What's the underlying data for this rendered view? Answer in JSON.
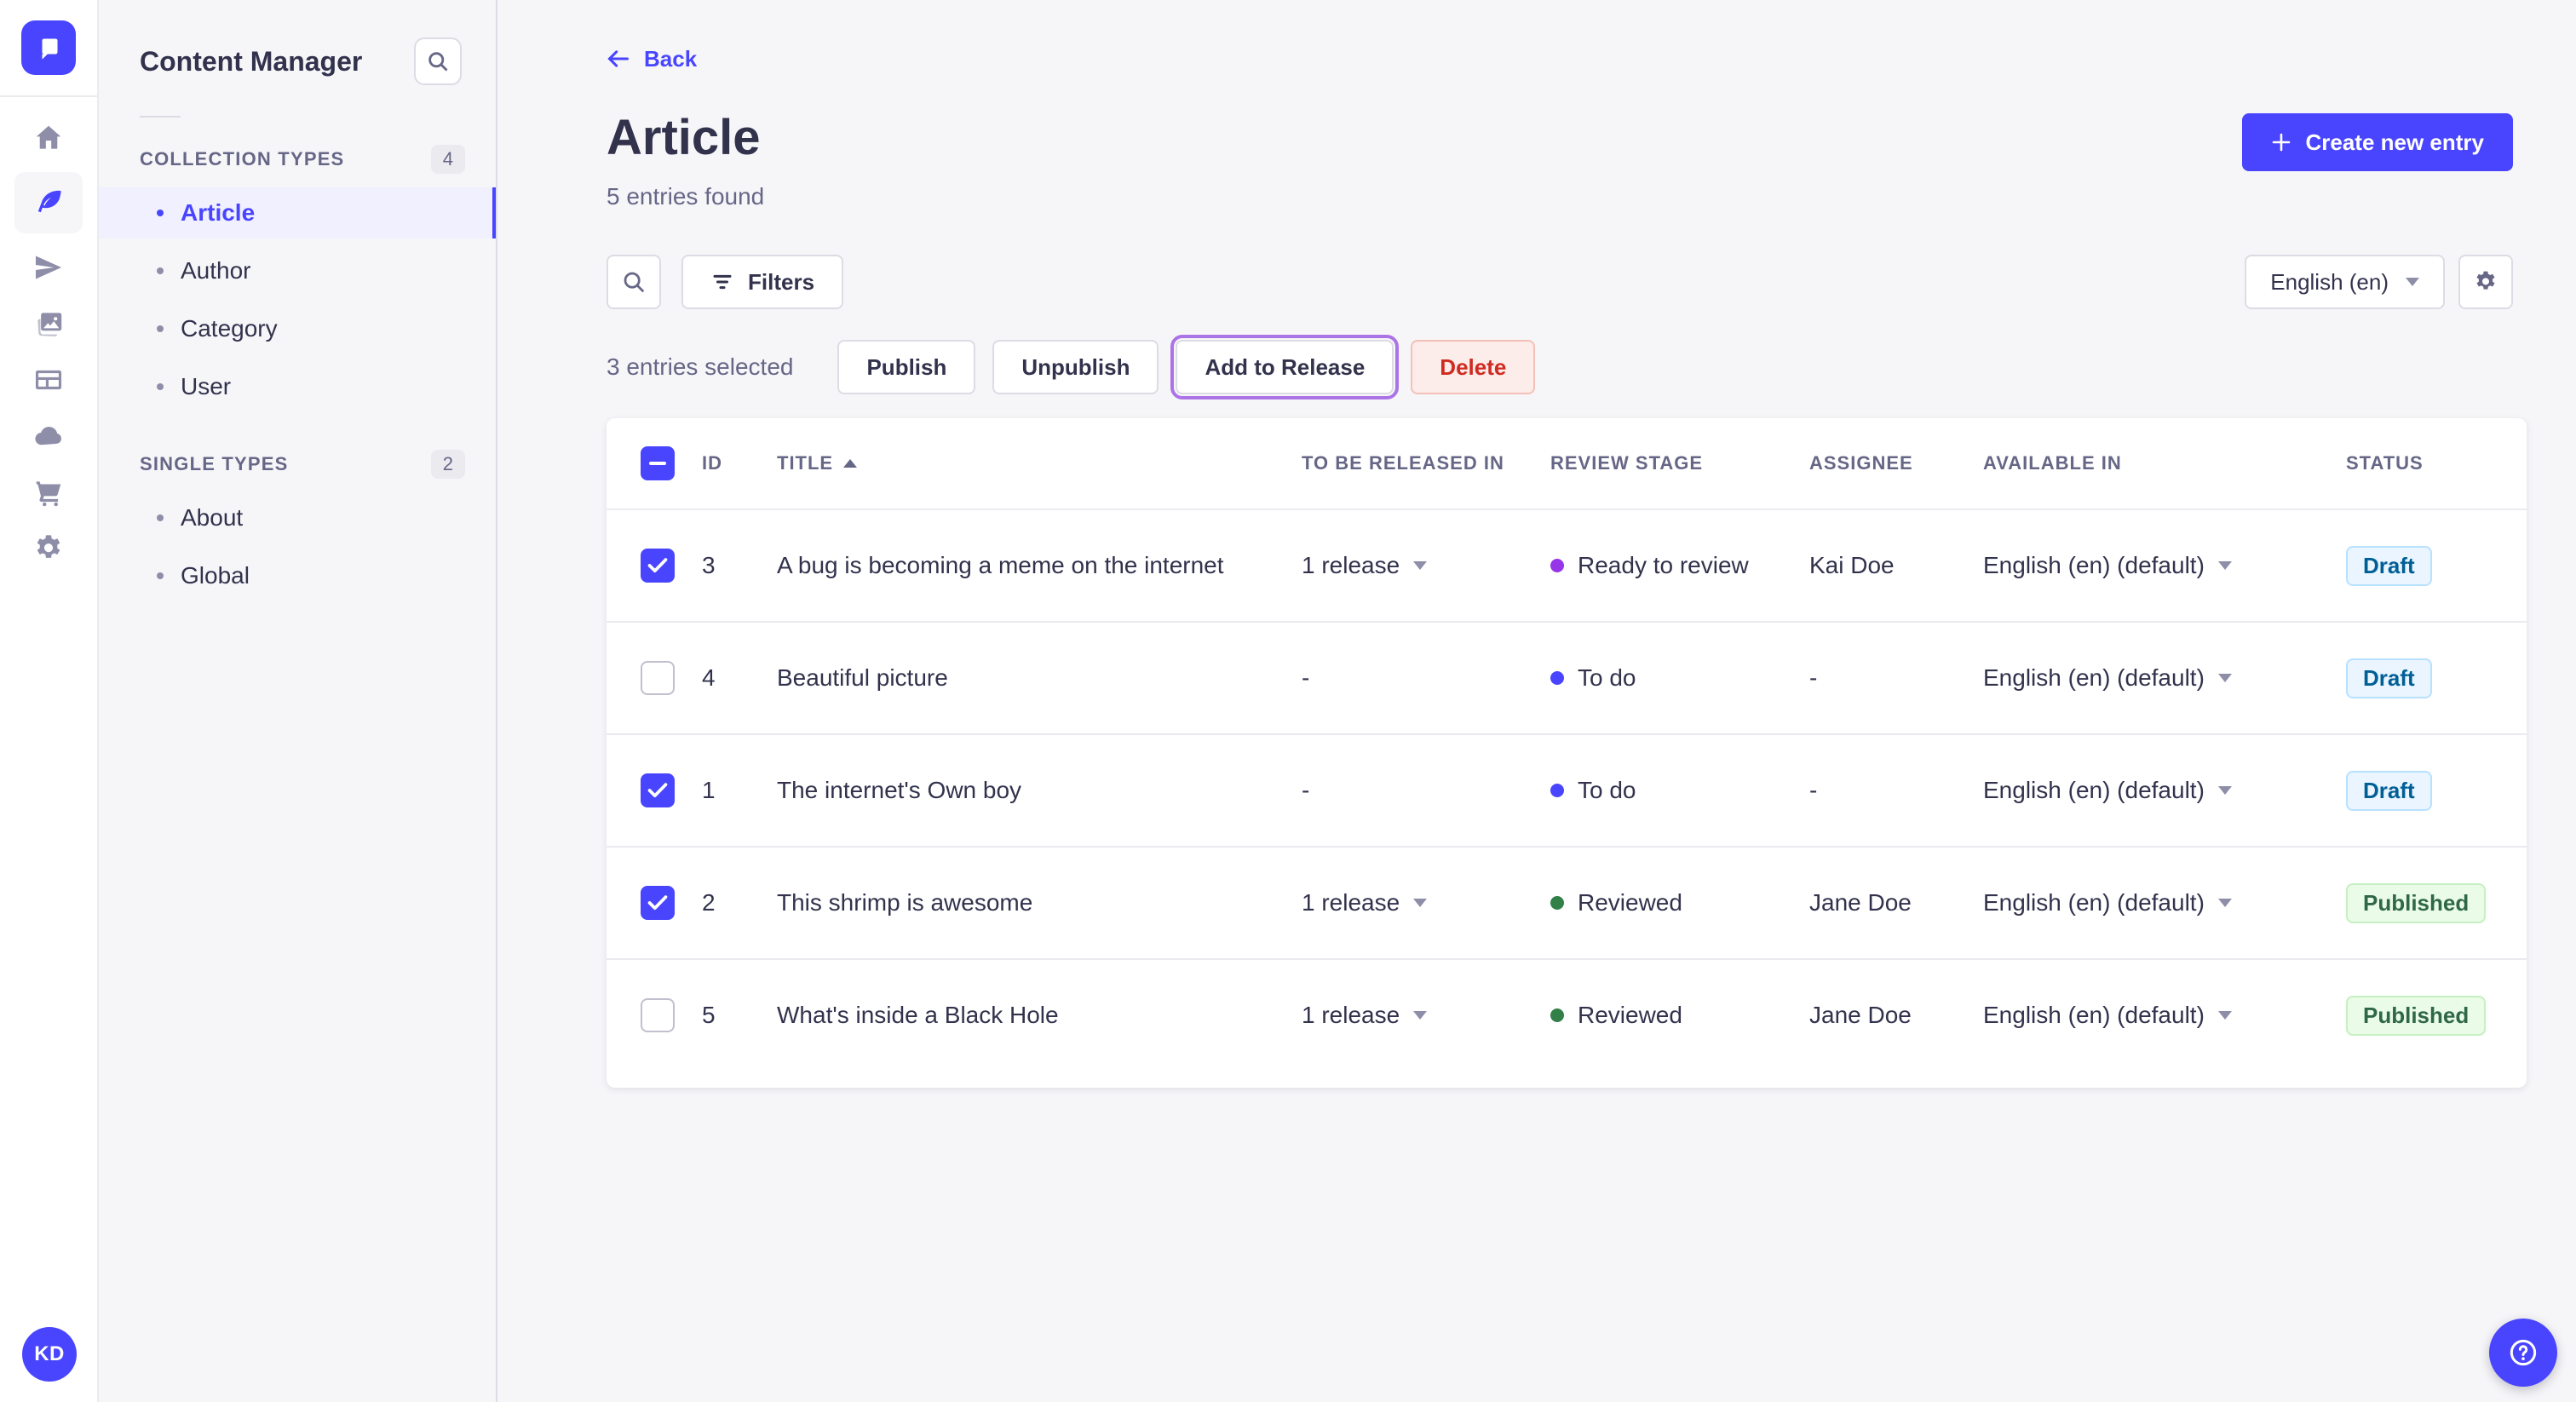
{
  "app": {
    "avatar_initials": "KD",
    "accent_color": "#4945ff",
    "release_outline_color": "#ac73e6",
    "nav_icons": [
      "home-icon",
      "content-manager-icon",
      "releases-icon",
      "media-library-icon",
      "content-type-builder-icon",
      "deploy-icon",
      "marketplace-icon",
      "settings-icon"
    ]
  },
  "subnav": {
    "title": "Content Manager",
    "sections": [
      {
        "label": "COLLECTION TYPES",
        "count": "4",
        "items": [
          {
            "label": "Article"
          },
          {
            "label": "Author"
          },
          {
            "label": "Category"
          },
          {
            "label": "User"
          }
        ]
      },
      {
        "label": "SINGLE TYPES",
        "count": "2",
        "items": [
          {
            "label": "About"
          },
          {
            "label": "Global"
          }
        ]
      }
    ]
  },
  "header": {
    "back_label": "Back",
    "title": "Article",
    "subtitle": "5 entries found",
    "create_button": "Create new entry"
  },
  "toolbar": {
    "filters_label": "Filters",
    "locale": "English (en)"
  },
  "selection": {
    "text": "3 entries selected",
    "publish": "Publish",
    "unpublish": "Unpublish",
    "add_to_release": "Add to Release",
    "delete": "Delete"
  },
  "table": {
    "columns": [
      "ID",
      "TITLE",
      "TO BE RELEASED IN",
      "REVIEW STAGE",
      "ASSIGNEE",
      "AVAILABLE IN",
      "STATUS"
    ],
    "status_colors": {
      "draft_text": "#006096",
      "draft_bg": "#eaf5ff",
      "published_text": "#2f6846",
      "published_bg": "#eafbe7"
    },
    "rows": [
      {
        "checked": true,
        "id": "3",
        "title": "A bug is becoming a meme on the internet",
        "release": "1 release",
        "has_release": true,
        "stage": "Ready to review",
        "stage_color": "#9736e8",
        "assignee": "Kai Doe",
        "locale": "English (en) (default)",
        "status": "Draft"
      },
      {
        "checked": false,
        "id": "4",
        "title": "Beautiful picture",
        "release": "-",
        "has_release": false,
        "stage": "To do",
        "stage_color": "#4945ff",
        "assignee": "-",
        "locale": "English (en) (default)",
        "status": "Draft"
      },
      {
        "checked": true,
        "id": "1",
        "title": "The internet's Own boy",
        "release": "-",
        "has_release": false,
        "stage": "To do",
        "stage_color": "#4945ff",
        "assignee": "-",
        "locale": "English (en) (default)",
        "status": "Draft"
      },
      {
        "checked": true,
        "id": "2",
        "title": "This shrimp is awesome",
        "release": "1 release",
        "has_release": true,
        "stage": "Reviewed",
        "stage_color": "#328048",
        "assignee": "Jane Doe",
        "locale": "English (en) (default)",
        "status": "Published"
      },
      {
        "checked": false,
        "id": "5",
        "title": "What's inside a Black Hole",
        "release": "1 release",
        "has_release": true,
        "stage": "Reviewed",
        "stage_color": "#328048",
        "assignee": "Jane Doe",
        "locale": "English (en) (default)",
        "status": "Published"
      }
    ]
  },
  "help": {
    "tooltip": "?"
  }
}
